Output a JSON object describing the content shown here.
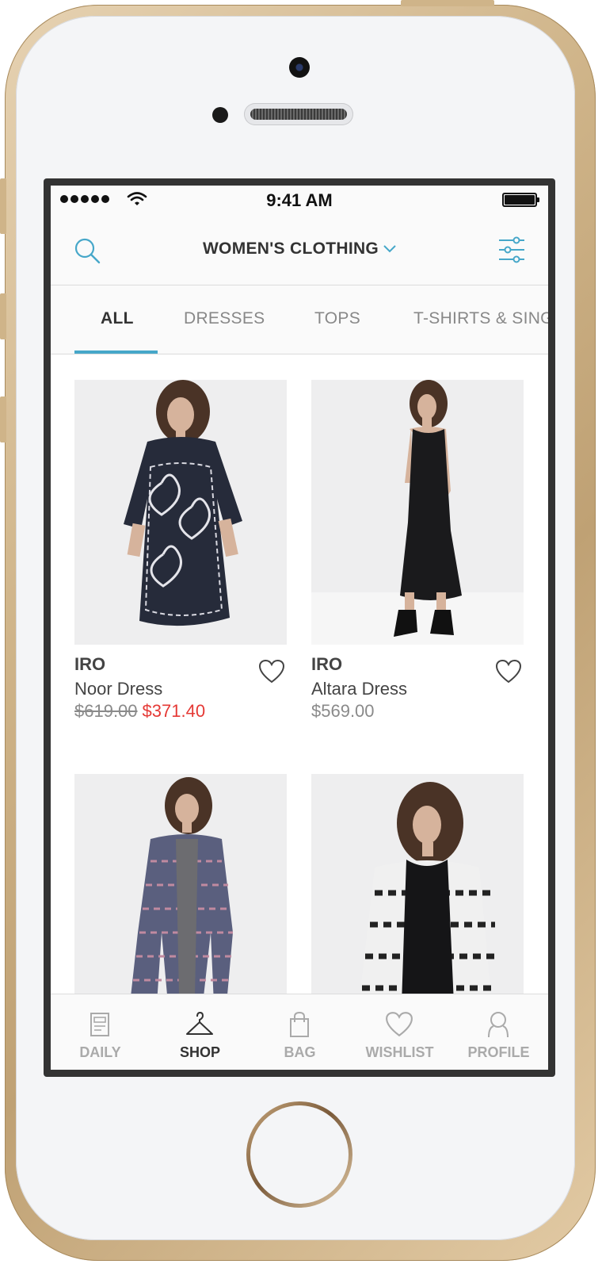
{
  "status_bar": {
    "time": "9:41 AM"
  },
  "nav": {
    "title": "WOMEN'S CLOTHING",
    "icons": {
      "search": "search-icon",
      "dropdown": "chevron-down-icon",
      "filter": "filter-sliders-icon"
    }
  },
  "tabs": [
    {
      "label": "ALL",
      "active": true
    },
    {
      "label": "DRESSES",
      "active": false
    },
    {
      "label": "TOPS",
      "active": false
    },
    {
      "label": "T-SHIRTS & SING",
      "active": false
    }
  ],
  "products": [
    {
      "brand": "IRO",
      "name": "Noor Dress",
      "price_original": "$619.00",
      "price_sale": "$371.40"
    },
    {
      "brand": "IRO",
      "name": "Altara Dress",
      "price": "$569.00"
    },
    {
      "brand": "",
      "name": "",
      "price": ""
    },
    {
      "brand": "",
      "name": "",
      "price": ""
    }
  ],
  "bottom_nav": [
    {
      "label": "DAILY",
      "icon": "newspaper-icon",
      "active": false
    },
    {
      "label": "SHOP",
      "icon": "hanger-icon",
      "active": true
    },
    {
      "label": "BAG",
      "icon": "shopping-bag-icon",
      "active": false
    },
    {
      "label": "WISHLIST",
      "icon": "heart-icon",
      "active": false
    },
    {
      "label": "PROFILE",
      "icon": "person-icon",
      "active": false
    }
  ],
  "colors": {
    "accent": "#46a7c9",
    "sale": "#e53935",
    "muted": "#8a8a8a",
    "text": "#333333"
  }
}
